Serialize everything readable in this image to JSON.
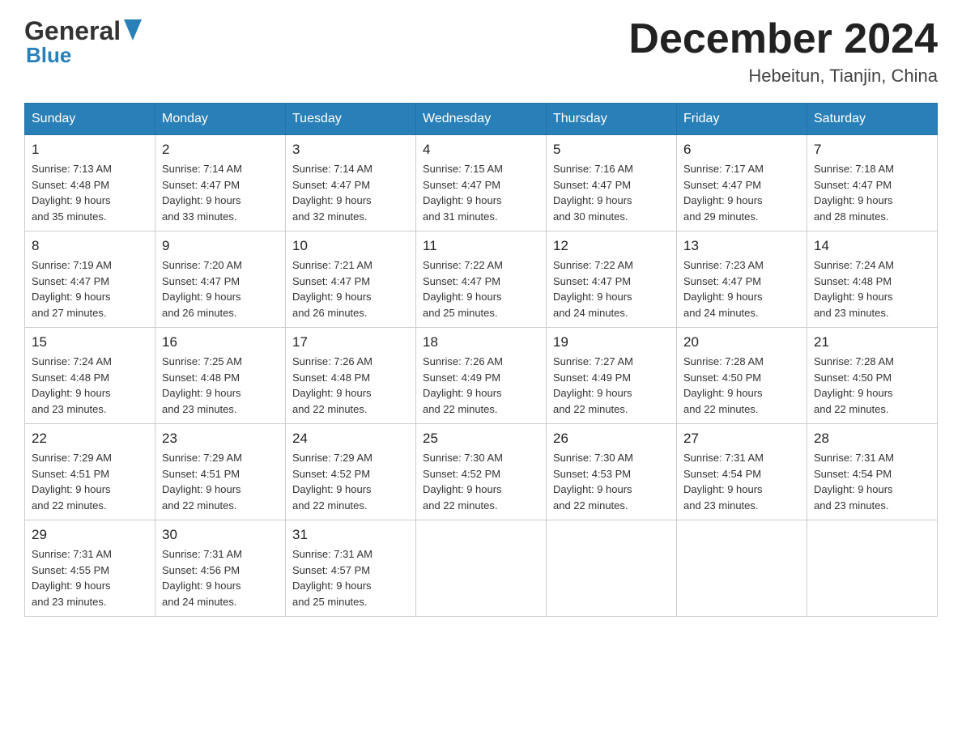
{
  "header": {
    "logo_general": "General",
    "logo_blue": "Blue",
    "month_title": "December 2024",
    "location": "Hebeitun, Tianjin, China"
  },
  "days_of_week": [
    "Sunday",
    "Monday",
    "Tuesday",
    "Wednesday",
    "Thursday",
    "Friday",
    "Saturday"
  ],
  "weeks": [
    [
      {
        "day": "1",
        "sunrise": "7:13 AM",
        "sunset": "4:48 PM",
        "daylight": "9 hours and 35 minutes."
      },
      {
        "day": "2",
        "sunrise": "7:14 AM",
        "sunset": "4:47 PM",
        "daylight": "9 hours and 33 minutes."
      },
      {
        "day": "3",
        "sunrise": "7:14 AM",
        "sunset": "4:47 PM",
        "daylight": "9 hours and 32 minutes."
      },
      {
        "day": "4",
        "sunrise": "7:15 AM",
        "sunset": "4:47 PM",
        "daylight": "9 hours and 31 minutes."
      },
      {
        "day": "5",
        "sunrise": "7:16 AM",
        "sunset": "4:47 PM",
        "daylight": "9 hours and 30 minutes."
      },
      {
        "day": "6",
        "sunrise": "7:17 AM",
        "sunset": "4:47 PM",
        "daylight": "9 hours and 29 minutes."
      },
      {
        "day": "7",
        "sunrise": "7:18 AM",
        "sunset": "4:47 PM",
        "daylight": "9 hours and 28 minutes."
      }
    ],
    [
      {
        "day": "8",
        "sunrise": "7:19 AM",
        "sunset": "4:47 PM",
        "daylight": "9 hours and 27 minutes."
      },
      {
        "day": "9",
        "sunrise": "7:20 AM",
        "sunset": "4:47 PM",
        "daylight": "9 hours and 26 minutes."
      },
      {
        "day": "10",
        "sunrise": "7:21 AM",
        "sunset": "4:47 PM",
        "daylight": "9 hours and 26 minutes."
      },
      {
        "day": "11",
        "sunrise": "7:22 AM",
        "sunset": "4:47 PM",
        "daylight": "9 hours and 25 minutes."
      },
      {
        "day": "12",
        "sunrise": "7:22 AM",
        "sunset": "4:47 PM",
        "daylight": "9 hours and 24 minutes."
      },
      {
        "day": "13",
        "sunrise": "7:23 AM",
        "sunset": "4:47 PM",
        "daylight": "9 hours and 24 minutes."
      },
      {
        "day": "14",
        "sunrise": "7:24 AM",
        "sunset": "4:48 PM",
        "daylight": "9 hours and 23 minutes."
      }
    ],
    [
      {
        "day": "15",
        "sunrise": "7:24 AM",
        "sunset": "4:48 PM",
        "daylight": "9 hours and 23 minutes."
      },
      {
        "day": "16",
        "sunrise": "7:25 AM",
        "sunset": "4:48 PM",
        "daylight": "9 hours and 23 minutes."
      },
      {
        "day": "17",
        "sunrise": "7:26 AM",
        "sunset": "4:48 PM",
        "daylight": "9 hours and 22 minutes."
      },
      {
        "day": "18",
        "sunrise": "7:26 AM",
        "sunset": "4:49 PM",
        "daylight": "9 hours and 22 minutes."
      },
      {
        "day": "19",
        "sunrise": "7:27 AM",
        "sunset": "4:49 PM",
        "daylight": "9 hours and 22 minutes."
      },
      {
        "day": "20",
        "sunrise": "7:28 AM",
        "sunset": "4:50 PM",
        "daylight": "9 hours and 22 minutes."
      },
      {
        "day": "21",
        "sunrise": "7:28 AM",
        "sunset": "4:50 PM",
        "daylight": "9 hours and 22 minutes."
      }
    ],
    [
      {
        "day": "22",
        "sunrise": "7:29 AM",
        "sunset": "4:51 PM",
        "daylight": "9 hours and 22 minutes."
      },
      {
        "day": "23",
        "sunrise": "7:29 AM",
        "sunset": "4:51 PM",
        "daylight": "9 hours and 22 minutes."
      },
      {
        "day": "24",
        "sunrise": "7:29 AM",
        "sunset": "4:52 PM",
        "daylight": "9 hours and 22 minutes."
      },
      {
        "day": "25",
        "sunrise": "7:30 AM",
        "sunset": "4:52 PM",
        "daylight": "9 hours and 22 minutes."
      },
      {
        "day": "26",
        "sunrise": "7:30 AM",
        "sunset": "4:53 PM",
        "daylight": "9 hours and 22 minutes."
      },
      {
        "day": "27",
        "sunrise": "7:31 AM",
        "sunset": "4:54 PM",
        "daylight": "9 hours and 23 minutes."
      },
      {
        "day": "28",
        "sunrise": "7:31 AM",
        "sunset": "4:54 PM",
        "daylight": "9 hours and 23 minutes."
      }
    ],
    [
      {
        "day": "29",
        "sunrise": "7:31 AM",
        "sunset": "4:55 PM",
        "daylight": "9 hours and 23 minutes."
      },
      {
        "day": "30",
        "sunrise": "7:31 AM",
        "sunset": "4:56 PM",
        "daylight": "9 hours and 24 minutes."
      },
      {
        "day": "31",
        "sunrise": "7:31 AM",
        "sunset": "4:57 PM",
        "daylight": "9 hours and 25 minutes."
      },
      null,
      null,
      null,
      null
    ]
  ],
  "labels": {
    "sunrise": "Sunrise:",
    "sunset": "Sunset:",
    "daylight": "Daylight:"
  }
}
